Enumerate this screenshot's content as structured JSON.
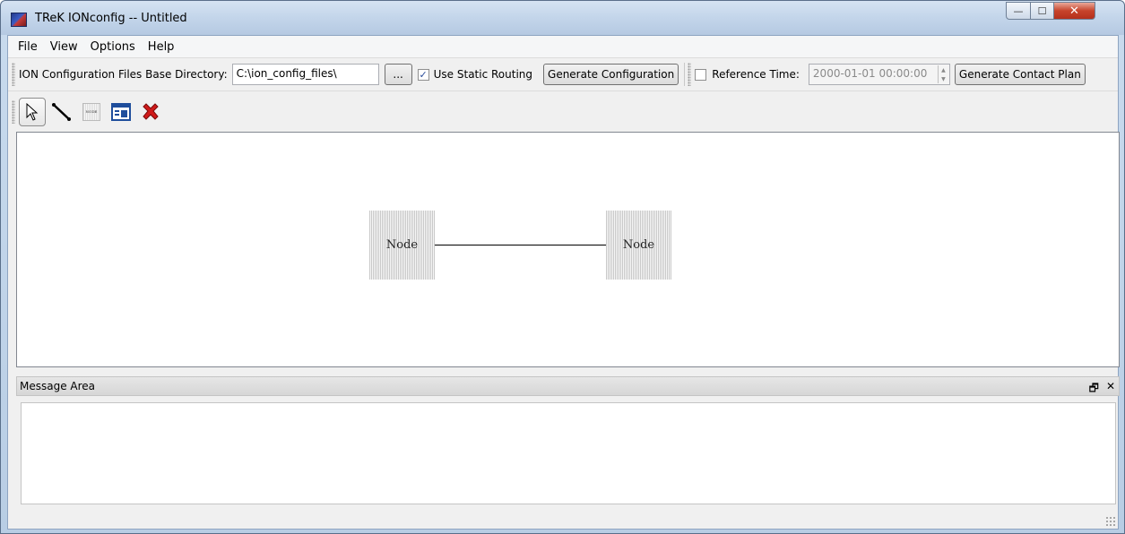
{
  "window": {
    "title": "TReK IONconfig -- Untitled",
    "minimize_glyph": "—",
    "maximize_glyph": "☐",
    "close_glyph": "✕"
  },
  "menu": {
    "items": [
      "File",
      "View",
      "Options",
      "Help"
    ]
  },
  "config_toolbar": {
    "base_dir_label": "ION Configuration Files Base Directory:",
    "base_dir_value": "C:\\ion_config_files\\",
    "browse_label": "...",
    "static_routing_label": "Use Static Routing",
    "static_routing_checked": true,
    "generate_config_label": "Generate Configuration",
    "reference_time_label": "Reference Time:",
    "reference_time_checked": false,
    "reference_time_value": "2000-01-01 00:00:00",
    "generate_contact_plan_label": "Generate Contact Plan"
  },
  "tools": {
    "node_icon_text": "NODE",
    "items": [
      {
        "name": "select-tool",
        "icon": "pointer-arrow-icon",
        "selected": true
      },
      {
        "name": "link-tool",
        "icon": "link-line-icon",
        "selected": false
      },
      {
        "name": "node-tool",
        "icon": "node-icon",
        "selected": false
      },
      {
        "name": "properties-tool",
        "icon": "table-window-icon",
        "selected": false
      },
      {
        "name": "delete-tool",
        "icon": "red-x-icon",
        "selected": false
      }
    ]
  },
  "diagram": {
    "nodes": [
      {
        "label": "Node"
      },
      {
        "label": "Node"
      }
    ],
    "edges": [
      {
        "from": 0,
        "to": 1
      }
    ]
  },
  "message_area": {
    "title": "Message Area",
    "restore_glyph": "🗗",
    "close_glyph": "✕",
    "content": ""
  },
  "colors": {
    "close_button": "#c7432b",
    "delete_icon": "#d01a1a",
    "checkbox_mark": "#2a4c9a"
  }
}
